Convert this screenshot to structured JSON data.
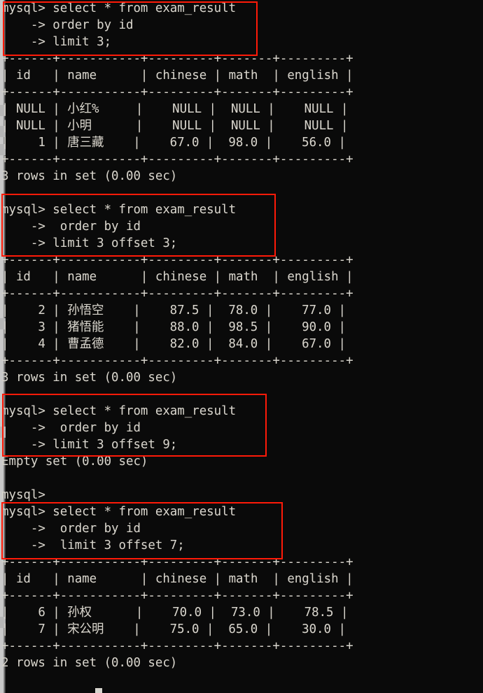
{
  "app": {
    "type": "terminal",
    "shell_prompt": "mysql>",
    "continuation_prompt": "->",
    "background_color": "#0a0a0a",
    "text_color": "#d6d4cd",
    "annotation_color": "#ff1a08"
  },
  "table": {
    "columns": [
      "id",
      "name",
      "chinese",
      "math",
      "english"
    ],
    "separator_row": "+------+-----------+---------+-------+---------+",
    "header_row": "| id   | name      | chinese | math  | english |"
  },
  "blocks": [
    {
      "id": "block-1",
      "command_lines": [
        "mysql> select * from exam_result",
        "    -> order by id",
        "    -> limit 3;"
      ],
      "result_rows": [
        [
          "NULL",
          "小红%",
          "NULL",
          "NULL",
          "NULL"
        ],
        [
          "NULL",
          "小明",
          "NULL",
          "NULL",
          "NULL"
        ],
        [
          "1",
          "唐三藏",
          "67.0",
          "98.0",
          "56.0"
        ]
      ],
      "status": "3 rows in set (0.00 sec)",
      "has_table": true
    },
    {
      "id": "block-2",
      "command_lines": [
        "mysql> select * from exam_result",
        "    ->  order by id",
        "    -> limit 3 offset 3;"
      ],
      "result_rows": [
        [
          "2",
          "孙悟空",
          "87.5",
          "78.0",
          "77.0"
        ],
        [
          "3",
          "猪悟能",
          "88.0",
          "98.5",
          "90.0"
        ],
        [
          "4",
          "曹孟德",
          "82.0",
          "84.0",
          "67.0"
        ]
      ],
      "status": "3 rows in set (0.00 sec)",
      "has_table": true
    },
    {
      "id": "block-3",
      "command_lines": [
        "mysql> select * from exam_result",
        "    ->  order by id",
        "    -> limit 3 offset 9;"
      ],
      "result_rows": [],
      "status": "Empty set (0.00 sec)",
      "has_table": false
    },
    {
      "id": "block-4",
      "command_lines": [
        "mysql> select * from exam_result",
        "    ->  order by id",
        "    ->  limit 3 offset 7;"
      ],
      "result_rows": [
        [
          "6",
          "孙权",
          "70.0",
          "73.0",
          "78.5"
        ],
        [
          "7",
          "宋公明",
          "75.0",
          "65.0",
          "30.0"
        ]
      ],
      "status": "2 rows in set (0.00 sec)",
      "has_table": true
    }
  ],
  "idle_prompt_line": "mysql>",
  "console_text": "mysql> select * from exam_result\n    -> order by id\n    -> limit 3;\n+------+-----------+---------+-------+---------+\n| id   | name      | chinese | math  | english |\n+------+-----------+---------+-------+---------+\n| NULL | 小红%     |    NULL |  NULL |    NULL |\n| NULL | 小明      |    NULL |  NULL |    NULL |\n|    1 | 唐三藏    |    67.0 |  98.0 |    56.0 |\n+------+-----------+---------+-------+---------+\n3 rows in set (0.00 sec)\n\nmysql> select * from exam_result\n    ->  order by id\n    -> limit 3 offset 3;\n+------+-----------+---------+-------+---------+\n| id   | name      | chinese | math  | english |\n+------+-----------+---------+-------+---------+\n|    2 | 孙悟空    |    87.5 |  78.0 |    77.0 |\n|    3 | 猪悟能    |    88.0 |  98.5 |    90.0 |\n|    4 | 曹孟德    |    82.0 |  84.0 |    67.0 |\n+------+-----------+---------+-------+---------+\n3 rows in set (0.00 sec)\n\nmysql> select * from exam_result\n    ->  order by id\n    -> limit 3 offset 9;\nEmpty set (0.00 sec)\n\nmysql>\nmysql> select * from exam_result\n    ->  order by id\n    ->  limit 3 offset 7;\n+------+-----------+---------+-------+---------+\n| id   | name      | chinese | math  | english |\n+------+-----------+---------+-------+---------+\n|    6 | 孙权      |    70.0 |  73.0 |    78.5 |\n|    7 | 宋公明    |    75.0 |  65.0 |    30.0 |\n+------+-----------+---------+-------+---------+\n2 rows in set (0.00 sec)\n"
}
